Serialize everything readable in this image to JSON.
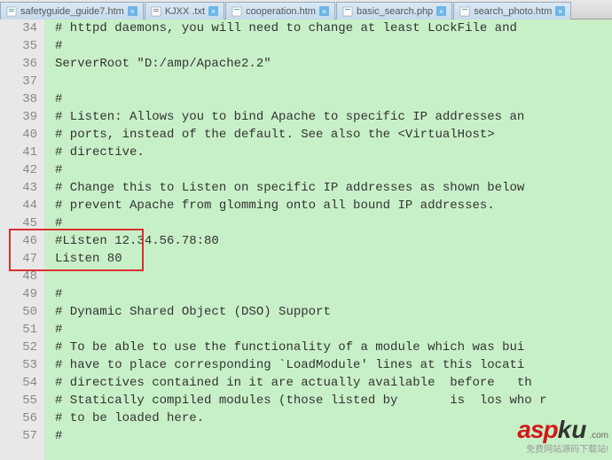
{
  "tabs": [
    {
      "label": "safetyguide_guide7.htm"
    },
    {
      "label": "KJXX .txt"
    },
    {
      "label": "cooperation.htm"
    },
    {
      "label": "basic_search.php"
    },
    {
      "label": "search_photo.htm"
    }
  ],
  "lines": [
    {
      "num": "34",
      "text": "# httpd daemons, you will need to change at least LockFile and"
    },
    {
      "num": "35",
      "text": "#"
    },
    {
      "num": "36",
      "text": "ServerRoot \"D:/amp/Apache2.2\""
    },
    {
      "num": "37",
      "text": ""
    },
    {
      "num": "38",
      "text": "#"
    },
    {
      "num": "39",
      "text": "# Listen: Allows you to bind Apache to specific IP addresses an"
    },
    {
      "num": "40",
      "text": "# ports, instead of the default. See also the <VirtualHost>"
    },
    {
      "num": "41",
      "text": "# directive."
    },
    {
      "num": "42",
      "text": "#"
    },
    {
      "num": "43",
      "text": "# Change this to Listen on specific IP addresses as shown below"
    },
    {
      "num": "44",
      "text": "# prevent Apache from glomming onto all bound IP addresses."
    },
    {
      "num": "45",
      "text": "#"
    },
    {
      "num": "46",
      "text": "#Listen 12.34.56.78:80"
    },
    {
      "num": "47",
      "text": "Listen 80"
    },
    {
      "num": "48",
      "text": ""
    },
    {
      "num": "49",
      "text": "#"
    },
    {
      "num": "50",
      "text": "# Dynamic Shared Object (DSO) Support"
    },
    {
      "num": "51",
      "text": "#"
    },
    {
      "num": "52",
      "text": "# To be able to use the functionality of a module which was bui"
    },
    {
      "num": "53",
      "text": "# have to place corresponding `LoadModule' lines at this locati"
    },
    {
      "num": "54",
      "text": "# directives contained in it are actually available  before   th"
    },
    {
      "num": "55",
      "text": "# Statically compiled modules (those listed by       is  los who r"
    },
    {
      "num": "56",
      "text": "# to be loaded here."
    },
    {
      "num": "57",
      "text": "#"
    }
  ],
  "watermark": {
    "asp": "asp",
    "ku": "ku",
    "cn": ".com",
    "tag": "免费网站源码下载站!"
  }
}
